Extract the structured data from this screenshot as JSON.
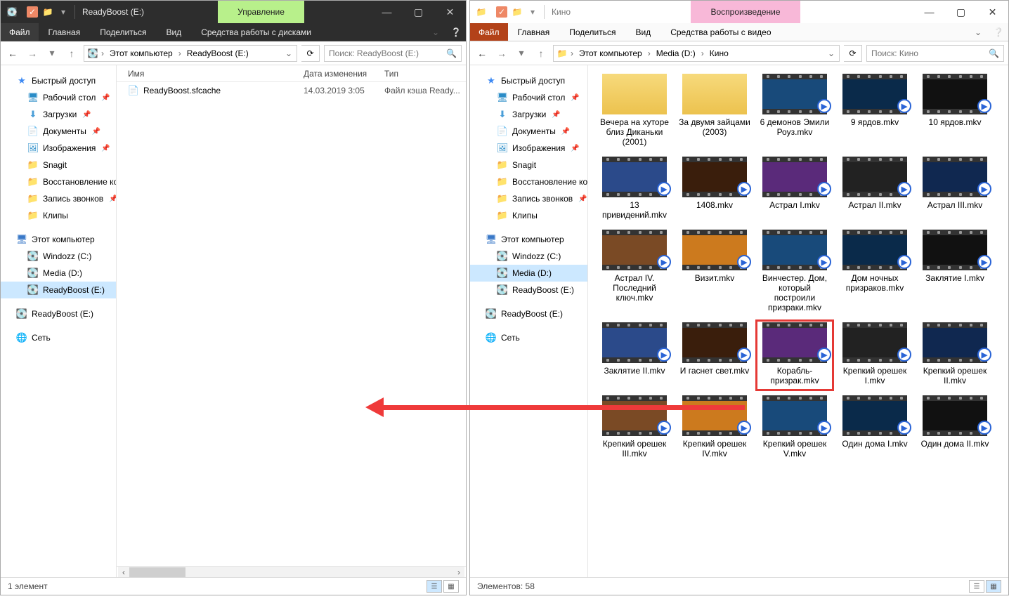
{
  "left": {
    "title": "ReadyBoost (E:)",
    "contextTab": "Управление",
    "ribbon": {
      "file": "Файл",
      "tabs": [
        "Главная",
        "Поделиться",
        "Вид"
      ],
      "context": "Средства работы с дисками"
    },
    "breadcrumb": [
      "Этот компьютер",
      "ReadyBoost (E:)"
    ],
    "searchPlaceholder": "Поиск: ReadyBoost (E:)",
    "columns": {
      "name": "Имя",
      "date": "Дата изменения",
      "type": "Тип"
    },
    "file": {
      "name": "ReadyBoost.sfcache",
      "date": "14.03.2019 3:05",
      "type": "Файл кэша Ready..."
    },
    "status": "1 элемент"
  },
  "right": {
    "title": "Кино",
    "contextTab": "Воспроизведение",
    "ribbon": {
      "file": "Файл",
      "tabs": [
        "Главная",
        "Поделиться",
        "Вид"
      ],
      "context": "Средства работы с видео"
    },
    "breadcrumb": [
      "Этот компьютер",
      "Media (D:)",
      "Кино"
    ],
    "searchPlaceholder": "Поиск: Кино",
    "status": "Элементов: 58",
    "items": [
      {
        "label": "Вечера на хуторе близ Диканьки (2001)",
        "type": "folder"
      },
      {
        "label": "За двумя зайцами (2003)",
        "type": "folder"
      },
      {
        "label": "6 демонов Эмили Роуз.mkv",
        "type": "video"
      },
      {
        "label": "9 ярдов.mkv",
        "type": "video"
      },
      {
        "label": "10 ярдов.mkv",
        "type": "video"
      },
      {
        "label": "13 привидений.mkv",
        "type": "video"
      },
      {
        "label": "1408.mkv",
        "type": "video"
      },
      {
        "label": "Астрал I.mkv",
        "type": "video"
      },
      {
        "label": "Астрал II.mkv",
        "type": "video"
      },
      {
        "label": "Астрал III.mkv",
        "type": "video"
      },
      {
        "label": "Астрал IV. Последний ключ.mkv",
        "type": "video"
      },
      {
        "label": "Визит.mkv",
        "type": "video"
      },
      {
        "label": "Винчестер. Дом, который построили призраки.mkv",
        "type": "video"
      },
      {
        "label": "Дом ночных призраков.mkv",
        "type": "video"
      },
      {
        "label": "Заклятие I.mkv",
        "type": "video"
      },
      {
        "label": "Заклятие II.mkv",
        "type": "video"
      },
      {
        "label": "И гаснет свет.mkv",
        "type": "video"
      },
      {
        "label": "Корабль-призрак.mkv",
        "type": "video",
        "selected": true
      },
      {
        "label": "Крепкий орешек I.mkv",
        "type": "video"
      },
      {
        "label": "Крепкий орешек II.mkv",
        "type": "video"
      },
      {
        "label": "Крепкий орешек III.mkv",
        "type": "video"
      },
      {
        "label": "Крепкий орешек IV.mkv",
        "type": "video"
      },
      {
        "label": "Крепкий орешек V.mkv",
        "type": "video"
      },
      {
        "label": "Один дома I.mkv",
        "type": "video"
      },
      {
        "label": "Один дома II.mkv",
        "type": "video"
      }
    ]
  },
  "sidebar": {
    "quick": "Быстрый доступ",
    "quickItems": [
      {
        "label": "Рабочий стол",
        "icon": "desktop",
        "pin": true
      },
      {
        "label": "Загрузки",
        "icon": "download",
        "pin": true
      },
      {
        "label": "Документы",
        "icon": "doc",
        "pin": true
      },
      {
        "label": "Изображения",
        "icon": "img",
        "pin": true
      },
      {
        "label": "Snagit",
        "icon": "folder"
      },
      {
        "label": "Восстановление ко",
        "icon": "folder"
      },
      {
        "label": "Запись звонков",
        "icon": "folder",
        "pin": true
      },
      {
        "label": "Клипы",
        "icon": "folder"
      }
    ],
    "pc": "Этот компьютер",
    "drives": [
      {
        "label": "Windozz (C:)"
      },
      {
        "label": "Media (D:)"
      },
      {
        "label": "ReadyBoost (E:)"
      }
    ],
    "readyBoostEject": "ReadyBoost (E:)",
    "net": "Сеть"
  }
}
